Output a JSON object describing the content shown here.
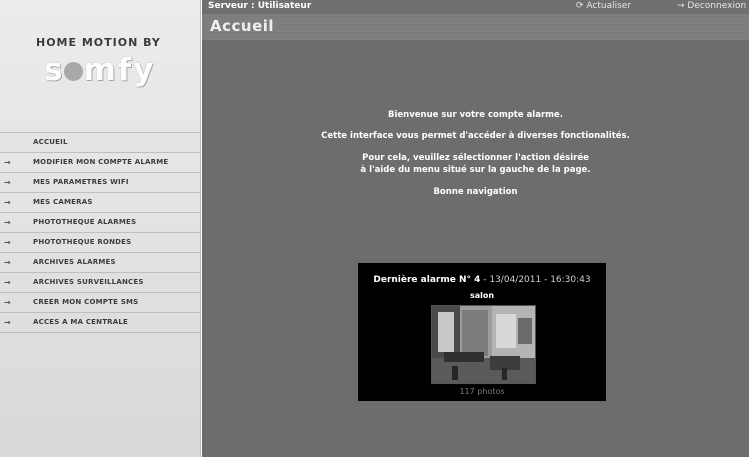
{
  "header": {
    "server_label": "Serveur : Utilisateur",
    "refresh_label": "Actualiser",
    "logout_label": "Deconnexion"
  },
  "page_title": "Accueil",
  "brand": {
    "small_text": "HOME MOTION BY",
    "logo_text": "somfy"
  },
  "sidebar": {
    "items": [
      {
        "label": "ACCUEIL",
        "active": true
      },
      {
        "label": "MODIFIER MON COMPTE ALARME"
      },
      {
        "label": "MES PARAMETRES WIFI"
      },
      {
        "label": "MES CAMERAS"
      },
      {
        "label": "PHOTOTHEQUE ALARMES"
      },
      {
        "label": "PHOTOTHEQUE RONDES"
      },
      {
        "label": "ARCHIVES ALARMES"
      },
      {
        "label": "ARCHIVES SURVEILLANCES"
      },
      {
        "label": "CREER MON COMPTE SMS"
      },
      {
        "label": "ACCES A MA CENTRALE"
      }
    ]
  },
  "welcome": {
    "line1": "Bienvenue sur votre compte alarme.",
    "line2": "Cette interface vous permet d'accéder à diverses fonctionalités.",
    "line3": "Pour cela, veuillez sélectionner l'action désirée",
    "line4": "à l'aide du menu situé sur la gauche de la page.",
    "line5": "Bonne navigation"
  },
  "last_alarm": {
    "title": "Dernière alarme N° 4",
    "datetime": "13/04/2011 - 16:30:43",
    "room": "salon",
    "photos_count": "117 photos"
  },
  "icons": {
    "nav_arrow": "arrow-right-icon",
    "refresh": "refresh-icon",
    "logout": "arrow-right-icon"
  },
  "colors": {
    "main_bg": "#6d6d6d",
    "topbar_bg": "#6f6f6f",
    "sidebar_bg": "#e6e6e6",
    "alarm_panel_bg": "#000000"
  }
}
